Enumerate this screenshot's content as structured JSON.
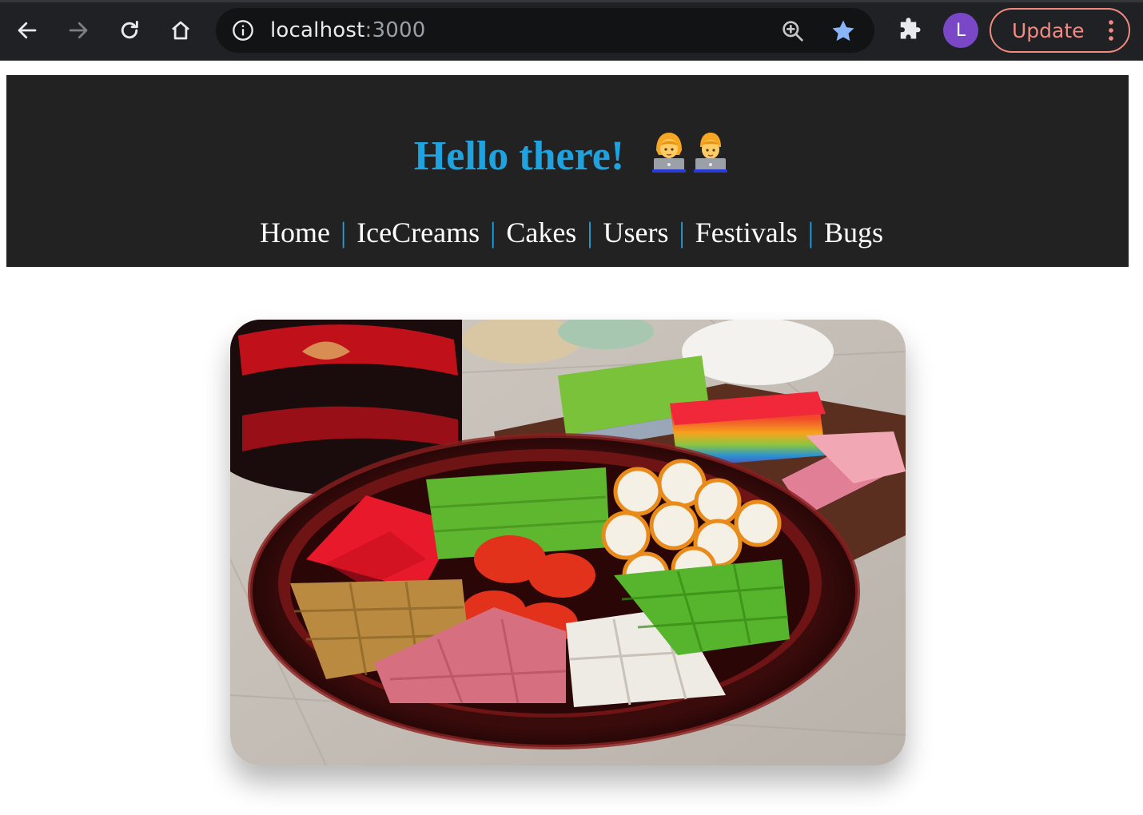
{
  "browser": {
    "url_host": "localhost",
    "url_port": ":3000",
    "profile_initial": "L",
    "update_label": "Update"
  },
  "header": {
    "title": "Hello there!",
    "nav": [
      {
        "label": "Home"
      },
      {
        "label": "IceCreams"
      },
      {
        "label": "Cakes"
      },
      {
        "label": "Users"
      },
      {
        "label": "Festivals"
      },
      {
        "label": "Bugs"
      }
    ],
    "separator": "|",
    "title_color": "#1fa3e0",
    "background": "#222222"
  },
  "hero": {
    "subject": "platter of colorful kuih desserts"
  }
}
